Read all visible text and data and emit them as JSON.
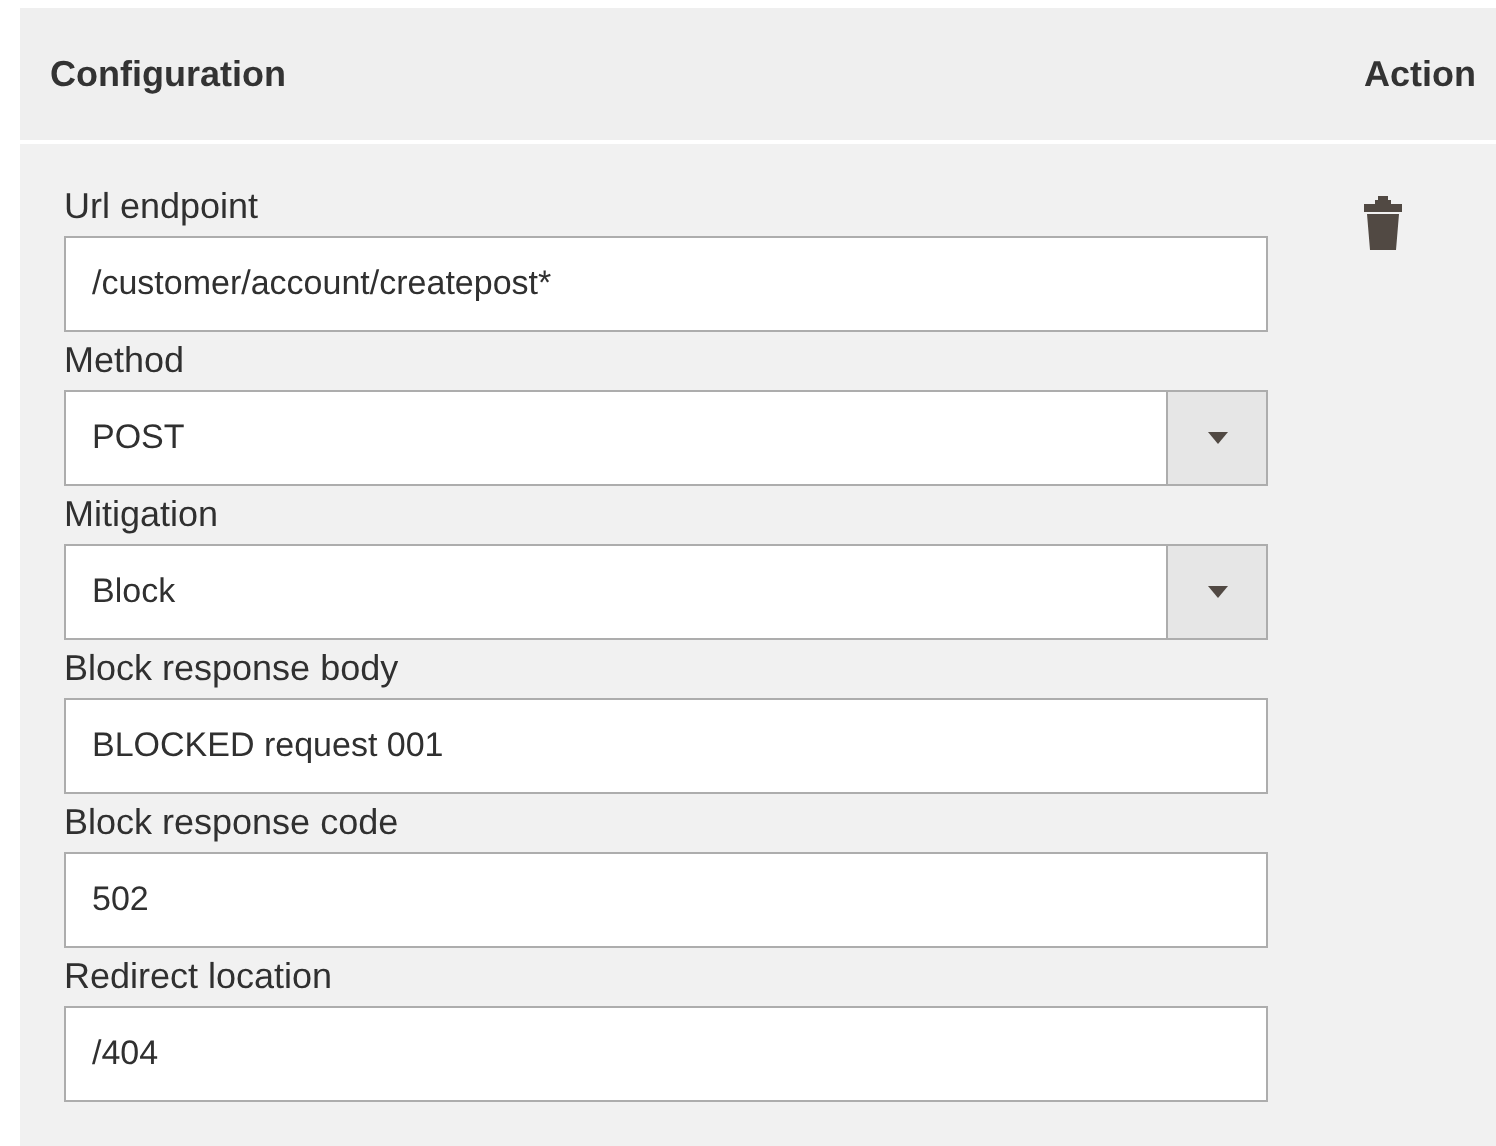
{
  "table": {
    "columns": [
      "Configuration",
      "Action"
    ],
    "fields": [
      {
        "label": "Url endpoint",
        "kind": "text",
        "value": "/customer/account/createpost*"
      },
      {
        "label": "Method",
        "kind": "select",
        "value": "POST"
      },
      {
        "label": "Mitigation",
        "kind": "select",
        "value": "Block"
      },
      {
        "label": "Block response body",
        "kind": "text",
        "value": "BLOCKED request 001"
      },
      {
        "label": "Block response code",
        "kind": "text",
        "value": "502"
      },
      {
        "label": "Redirect location",
        "kind": "text",
        "value": "/404"
      }
    ]
  }
}
